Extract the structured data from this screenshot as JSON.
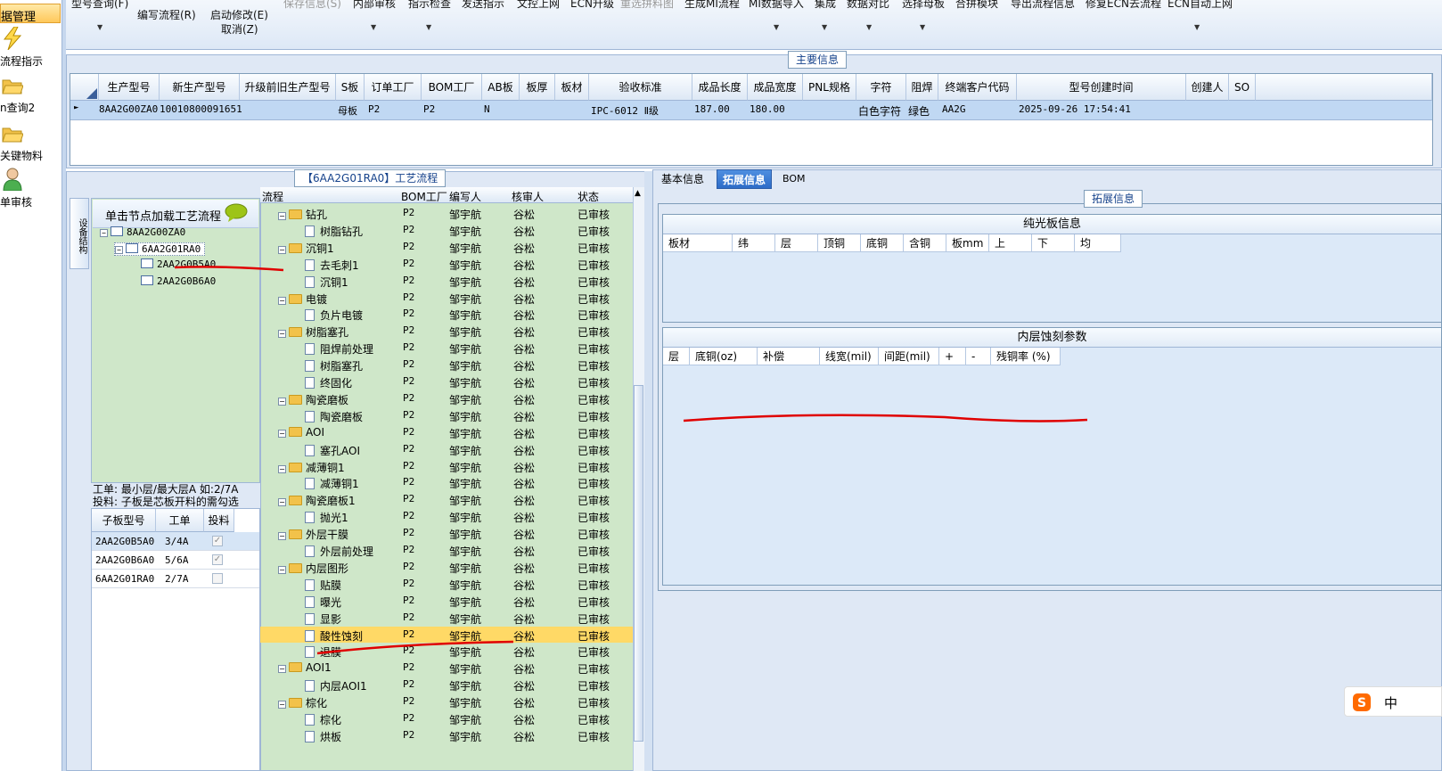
{
  "nav": {
    "header": "据管理",
    "items": [
      {
        "label": "流程指示",
        "icon": "lightning-icon"
      },
      {
        "label": "n查询2",
        "icon": "folder-open-icon"
      },
      {
        "label": "关键物料",
        "icon": "folder-open-icon"
      },
      {
        "label": "单审核",
        "icon": "user-icon"
      }
    ]
  },
  "toolbar": {
    "items": [
      "型号查询(F)",
      "编写流程(R)",
      "启动修改(E)",
      "取消(Z)",
      "保存信息(S)",
      "内部审核",
      "指示检查",
      "发送指示",
      "文控上网",
      "ECN升级",
      "重选拼料图",
      "生成MI流程",
      "MI数据导入",
      "集成",
      "数据对比",
      "选择母板",
      "合拼模块",
      "导出流程信息",
      "修复ECN去流程",
      "ECN自动上网"
    ]
  },
  "main_info": {
    "title": "主要信息",
    "columns": [
      "生产型号",
      "新生产型号",
      "升级前旧生产型号",
      "S板",
      "订单工厂",
      "BOM工厂",
      "AB板",
      "板厚",
      "板材",
      "验收标准",
      "成品长度",
      "成品宽度",
      "PNL规格",
      "字符",
      "阻焊",
      "终端客户代码",
      "型号创建时间",
      "创建人",
      "SO"
    ],
    "row": {
      "生产型号": "8AA2G00ZA0",
      "新生产型号": "10010800091651",
      "升级前旧生产型号": "",
      "S板": "母板",
      "订单工厂": "P2",
      "BOM工厂": "P2",
      "AB板": "N",
      "板厚": "",
      "板材": "",
      "验收标准": "IPC-6012 Ⅱ级",
      "成品长度": "187.00",
      "成品宽度": "180.00",
      "PNL规格": "",
      "字符": "白色字符",
      "阻焊": "绿色",
      "终端客户代码": "AA2G",
      "型号创建时间": "2025-09-26 17:54:41",
      "创建人": "",
      "SO": ""
    }
  },
  "process": {
    "title": "【6AA2G01RA0】工艺流程",
    "vtab": "设备结构",
    "tree_header": "单击节点加载工艺流程",
    "tree": [
      "8AA2G00ZA0",
      "6AA2G01RA0",
      "2AA2G0B5A0",
      "2AA2G0B6A0"
    ],
    "info_lines": [
      "工单: 最小层/最大层A 如:2/7A",
      "投料: 子板是芯板开料的需勾选"
    ],
    "sub_columns": [
      "子板型号",
      "工单",
      "投料"
    ],
    "sub_rows": [
      {
        "model": "2AA2G0B5A0",
        "order": "3/4A",
        "checked": true
      },
      {
        "model": "2AA2G0B6A0",
        "order": "5/6A",
        "checked": true
      },
      {
        "model": "6AA2G01RA0",
        "order": "2/7A",
        "checked": false
      }
    ],
    "list_columns": [
      "流程",
      "BOM工厂",
      "编写人",
      "核审人",
      "状态"
    ],
    "steps": [
      {
        "name": "钻孔",
        "level": 0,
        "bom": "P2",
        "writer": "邹宇航",
        "reviewer": "谷松",
        "status": "已审核"
      },
      {
        "name": "树脂钻孔",
        "level": 1,
        "bom": "P2",
        "writer": "邹宇航",
        "reviewer": "谷松",
        "status": "已审核"
      },
      {
        "name": "沉铜1",
        "level": 0,
        "bom": "P2",
        "writer": "邹宇航",
        "reviewer": "谷松",
        "status": "已审核"
      },
      {
        "name": "去毛刺1",
        "level": 1,
        "bom": "P2",
        "writer": "邹宇航",
        "reviewer": "谷松",
        "status": "已审核"
      },
      {
        "name": "沉铜1",
        "level": 1,
        "bom": "P2",
        "writer": "邹宇航",
        "reviewer": "谷松",
        "status": "已审核"
      },
      {
        "name": "电镀",
        "level": 0,
        "bom": "P2",
        "writer": "邹宇航",
        "reviewer": "谷松",
        "status": "已审核"
      },
      {
        "name": "负片电镀",
        "level": 1,
        "bom": "P2",
        "writer": "邹宇航",
        "reviewer": "谷松",
        "status": "已审核"
      },
      {
        "name": "树脂塞孔",
        "level": 0,
        "bom": "P2",
        "writer": "邹宇航",
        "reviewer": "谷松",
        "status": "已审核"
      },
      {
        "name": "阻焊前处理",
        "level": 1,
        "bom": "P2",
        "writer": "邹宇航",
        "reviewer": "谷松",
        "status": "已审核"
      },
      {
        "name": "树脂塞孔",
        "level": 1,
        "bom": "P2",
        "writer": "邹宇航",
        "reviewer": "谷松",
        "status": "已审核"
      },
      {
        "name": "终固化",
        "level": 1,
        "bom": "P2",
        "writer": "邹宇航",
        "reviewer": "谷松",
        "status": "已审核"
      },
      {
        "name": "陶瓷磨板",
        "level": 0,
        "bom": "P2",
        "writer": "邹宇航",
        "reviewer": "谷松",
        "status": "已审核"
      },
      {
        "name": "陶瓷磨板",
        "level": 1,
        "bom": "P2",
        "writer": "邹宇航",
        "reviewer": "谷松",
        "status": "已审核"
      },
      {
        "name": "AOI",
        "level": 0,
        "bom": "P2",
        "writer": "邹宇航",
        "reviewer": "谷松",
        "status": "已审核"
      },
      {
        "name": "塞孔AOI",
        "level": 1,
        "bom": "P2",
        "writer": "邹宇航",
        "reviewer": "谷松",
        "status": "已审核"
      },
      {
        "name": "减薄铜1",
        "level": 0,
        "bom": "P2",
        "writer": "邹宇航",
        "reviewer": "谷松",
        "status": "已审核"
      },
      {
        "name": "减薄铜1",
        "level": 1,
        "bom": "P2",
        "writer": "邹宇航",
        "reviewer": "谷松",
        "status": "已审核"
      },
      {
        "name": "陶瓷磨板1",
        "level": 0,
        "bom": "P2",
        "writer": "邹宇航",
        "reviewer": "谷松",
        "status": "已审核"
      },
      {
        "name": "抛光1",
        "level": 1,
        "bom": "P2",
        "writer": "邹宇航",
        "reviewer": "谷松",
        "status": "已审核"
      },
      {
        "name": "外层干膜",
        "level": 0,
        "bom": "P2",
        "writer": "邹宇航",
        "reviewer": "谷松",
        "status": "已审核"
      },
      {
        "name": "外层前处理",
        "level": 1,
        "bom": "P2",
        "writer": "邹宇航",
        "reviewer": "谷松",
        "status": "已审核"
      },
      {
        "name": "内层图形",
        "level": 0,
        "bom": "P2",
        "writer": "邹宇航",
        "reviewer": "谷松",
        "status": "已审核"
      },
      {
        "name": "贴膜",
        "level": 1,
        "bom": "P2",
        "writer": "邹宇航",
        "reviewer": "谷松",
        "status": "已审核"
      },
      {
        "name": "曝光",
        "level": 1,
        "bom": "P2",
        "writer": "邹宇航",
        "reviewer": "谷松",
        "status": "已审核"
      },
      {
        "name": "显影",
        "level": 1,
        "bom": "P2",
        "writer": "邹宇航",
        "reviewer": "谷松",
        "status": "已审核"
      },
      {
        "name": "酸性蚀刻",
        "level": 1,
        "bom": "P2",
        "writer": "邹宇航",
        "reviewer": "谷松",
        "status": "已审核",
        "selected": true
      },
      {
        "name": "退膜",
        "level": 1,
        "bom": "P2",
        "writer": "邹宇航",
        "reviewer": "谷松",
        "status": "已审核"
      },
      {
        "name": "AOI1",
        "level": 0,
        "bom": "P2",
        "writer": "邹宇航",
        "reviewer": "谷松",
        "status": "已审核"
      },
      {
        "name": "内层AOI1",
        "level": 1,
        "bom": "P2",
        "writer": "邹宇航",
        "reviewer": "谷松",
        "status": "已审核"
      },
      {
        "name": "棕化",
        "level": 0,
        "bom": "P2",
        "writer": "邹宇航",
        "reviewer": "谷松",
        "status": "已审核"
      },
      {
        "name": "棕化",
        "level": 1,
        "bom": "P2",
        "writer": "邹宇航",
        "reviewer": "谷松",
        "status": "已审核"
      },
      {
        "name": "烘板",
        "level": 1,
        "bom": "P2",
        "writer": "邹宇航",
        "reviewer": "谷松",
        "status": "已审核"
      }
    ]
  },
  "right": {
    "tabs": [
      "基本信息",
      "拓展信息",
      "BOM"
    ],
    "panel_title": "拓展信息",
    "gloss_title": "纯光板信息",
    "gloss_cols": [
      "板材",
      "纬",
      "层",
      "顶铜",
      "底铜",
      "含铜",
      "板mm",
      "上",
      "下",
      "均"
    ],
    "etch_title": "内层蚀刻参数",
    "etch_cols": [
      "层",
      "底铜(oz)",
      "补偿",
      "线宽(mil)",
      "间距(mil)",
      "+",
      "-",
      "残铜率 (%)"
    ]
  },
  "ime": {
    "label": "中"
  },
  "colors": {
    "selected_row": "#ffd966",
    "tree_bg": "#cfe7c9",
    "accent": "#2d6cc8",
    "annotation": "#e00000"
  }
}
